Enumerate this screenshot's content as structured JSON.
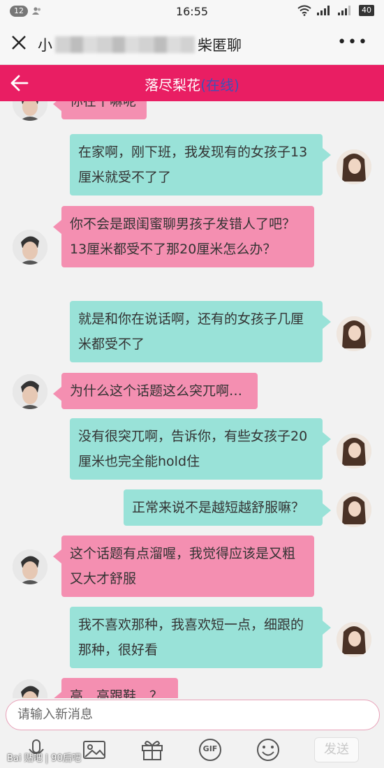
{
  "status_bar": {
    "notification_count": "12",
    "time": "16:55",
    "battery": "40"
  },
  "browser_bar": {
    "title_prefix": "小",
    "title_suffix": "柴匿聊",
    "more": "•••"
  },
  "chat_header": {
    "name": "落尽梨花",
    "status": "(在线)"
  },
  "messages": [
    {
      "side": "left",
      "text": "你在干嘛呢"
    },
    {
      "side": "right",
      "text": "在家啊，刚下班，我发现有的女孩子13厘米就受不了了"
    },
    {
      "side": "left",
      "text": "你不会是跟闺蜜聊男孩子发错人了吧？13厘米都受不了那20厘米怎么办？"
    },
    {
      "side": "right",
      "text": "就是和你在说话啊，还有的女孩子几厘米都受不了"
    },
    {
      "side": "left",
      "text": "为什么这个话题这么突兀啊…"
    },
    {
      "side": "right",
      "text": "没有很突兀啊，告诉你，有些女孩子20厘米也完全能hold住"
    },
    {
      "side": "right",
      "text": "正常来说不是越短越舒服嘛？"
    },
    {
      "side": "left",
      "text": "这个话题有点溜喔，我觉得应该是又粗又大才舒服"
    },
    {
      "side": "right",
      "text": "我不喜欢那种，我喜欢短一点，细跟的那种，很好看"
    },
    {
      "side": "left",
      "text": "高…高跟鞋…？"
    }
  ],
  "input": {
    "placeholder": "请输入新消息"
  },
  "toolbar": {
    "gif_label": "GIF",
    "send_label": "发送"
  },
  "watermark": "Bai 贴吧 | 90后吧"
}
